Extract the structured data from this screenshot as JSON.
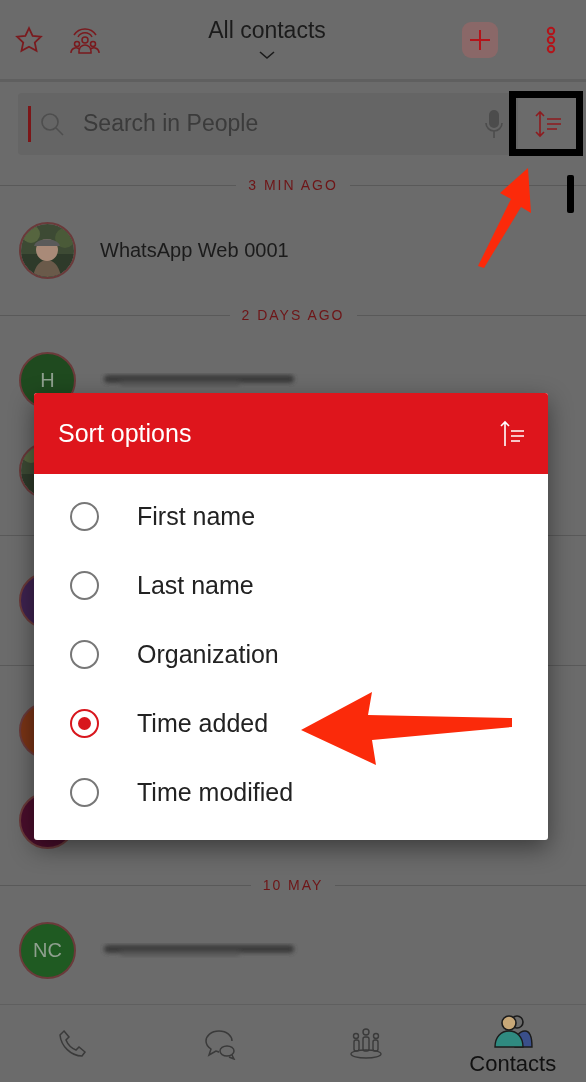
{
  "top_bar": {
    "title": "All contacts"
  },
  "search": {
    "placeholder": "Search in People"
  },
  "contacts": [
    {
      "kind": "section",
      "label": "3 MIN AGO"
    },
    {
      "kind": "contact",
      "photo": true,
      "name": "WhatsApp Web 0001"
    },
    {
      "kind": "section",
      "label": "2 DAYS AGO"
    },
    {
      "kind": "contact",
      "photo": false,
      "initials": "H",
      "color": "#1f4a1f",
      "redacted": true
    },
    {
      "kind": "contact",
      "photo": true
    },
    {
      "kind": "section"
    },
    {
      "kind": "contact",
      "photo": false,
      "color": "#3e2350"
    },
    {
      "kind": "section"
    },
    {
      "kind": "contact",
      "photo": false,
      "color": "#7a3416"
    },
    {
      "kind": "contact",
      "photo": false,
      "color": "#4a0e2c"
    },
    {
      "kind": "section",
      "label": "10 MAY"
    },
    {
      "kind": "contact",
      "photo": false,
      "initials": "NC",
      "color": "#1f5a22",
      "redacted": true
    }
  ],
  "dialog": {
    "title": "Sort options",
    "options": [
      {
        "label": "First name",
        "selected": false
      },
      {
        "label": "Last name",
        "selected": false
      },
      {
        "label": "Organization",
        "selected": false
      },
      {
        "label": "Time added",
        "selected": true
      },
      {
        "label": "Time modified",
        "selected": false
      }
    ]
  },
  "bottom_nav": [
    {
      "kind": "calls",
      "selected": false
    },
    {
      "kind": "chats",
      "selected": false
    },
    {
      "kind": "groups",
      "selected": false
    },
    {
      "kind": "contacts",
      "selected": true,
      "label": "Contacts"
    }
  ]
}
